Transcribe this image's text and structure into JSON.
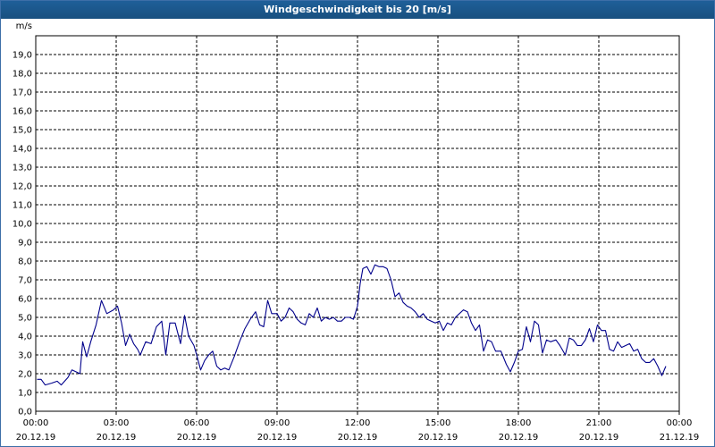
{
  "window": {
    "title": "Windgeschwindigkeit bis 20 [m/s]"
  },
  "chart_data": {
    "type": "line",
    "title": "Windgeschwindigkeit bis 20 [m/s]",
    "ylabel": "m/s",
    "xlabel": "",
    "ylim": [
      0,
      20
    ],
    "yticks": [
      "0,0",
      "1,0",
      "2,0",
      "3,0",
      "4,0",
      "5,0",
      "6,0",
      "7,0",
      "8,0",
      "9,0",
      "10,0",
      "11,0",
      "12,0",
      "13,0",
      "14,0",
      "15,0",
      "16,0",
      "17,0",
      "18,0",
      "19,0"
    ],
    "xlim": [
      0,
      24
    ],
    "xticks": [
      {
        "time": "00:00",
        "date": "20.12.19",
        "hour": 0
      },
      {
        "time": "03:00",
        "date": "20.12.19",
        "hour": 3
      },
      {
        "time": "06:00",
        "date": "20.12.19",
        "hour": 6
      },
      {
        "time": "09:00",
        "date": "20.12.19",
        "hour": 9
      },
      {
        "time": "12:00",
        "date": "20.12.19",
        "hour": 12
      },
      {
        "time": "15:00",
        "date": "20.12.19",
        "hour": 15
      },
      {
        "time": "18:00",
        "date": "20.12.19",
        "hour": 18
      },
      {
        "time": "21:00",
        "date": "20.12.19",
        "hour": 21
      },
      {
        "time": "00:00",
        "date": "21.12.19",
        "hour": 24
      }
    ],
    "grid": true,
    "line_color": "#00008b",
    "series": [
      {
        "name": "",
        "points": [
          [
            0.05,
            1.7
          ],
          [
            0.2,
            1.7
          ],
          [
            0.35,
            1.4
          ],
          [
            0.6,
            1.5
          ],
          [
            0.8,
            1.6
          ],
          [
            0.95,
            1.4
          ],
          [
            1.2,
            1.8
          ],
          [
            1.35,
            2.2
          ],
          [
            1.5,
            2.1
          ],
          [
            1.65,
            2.0
          ],
          [
            1.75,
            3.7
          ],
          [
            1.9,
            2.9
          ],
          [
            2.05,
            3.7
          ],
          [
            2.25,
            4.6
          ],
          [
            2.45,
            5.9
          ],
          [
            2.65,
            5.2
          ],
          [
            2.9,
            5.4
          ],
          [
            3.05,
            5.6
          ],
          [
            3.2,
            4.7
          ],
          [
            3.35,
            3.5
          ],
          [
            3.5,
            4.1
          ],
          [
            3.65,
            3.6
          ],
          [
            3.8,
            3.3
          ],
          [
            3.9,
            3.0
          ],
          [
            4.1,
            3.7
          ],
          [
            4.3,
            3.6
          ],
          [
            4.5,
            4.5
          ],
          [
            4.7,
            4.8
          ],
          [
            4.85,
            3.0
          ],
          [
            5.0,
            4.7
          ],
          [
            5.2,
            4.7
          ],
          [
            5.4,
            3.6
          ],
          [
            5.55,
            5.1
          ],
          [
            5.7,
            4.0
          ],
          [
            5.9,
            3.5
          ],
          [
            6.0,
            3.0
          ],
          [
            6.15,
            2.2
          ],
          [
            6.3,
            2.7
          ],
          [
            6.45,
            3.0
          ],
          [
            6.6,
            3.2
          ],
          [
            6.75,
            2.4
          ],
          [
            6.9,
            2.2
          ],
          [
            7.05,
            2.3
          ],
          [
            7.2,
            2.2
          ],
          [
            7.4,
            2.9
          ],
          [
            7.6,
            3.7
          ],
          [
            7.8,
            4.4
          ],
          [
            8.0,
            4.9
          ],
          [
            8.2,
            5.3
          ],
          [
            8.35,
            4.6
          ],
          [
            8.5,
            4.5
          ],
          [
            8.65,
            5.9
          ],
          [
            8.8,
            5.2
          ],
          [
            9.0,
            5.2
          ],
          [
            9.15,
            4.8
          ],
          [
            9.3,
            5.0
          ],
          [
            9.45,
            5.5
          ],
          [
            9.6,
            5.3
          ],
          [
            9.75,
            4.9
          ],
          [
            9.9,
            4.7
          ],
          [
            10.05,
            4.6
          ],
          [
            10.2,
            5.2
          ],
          [
            10.35,
            5.0
          ],
          [
            10.5,
            5.5
          ],
          [
            10.65,
            4.8
          ],
          [
            10.8,
            5.0
          ],
          [
            10.95,
            4.9
          ],
          [
            11.1,
            5.0
          ],
          [
            11.25,
            4.8
          ],
          [
            11.4,
            4.8
          ],
          [
            11.55,
            5.0
          ],
          [
            11.7,
            5.0
          ],
          [
            11.85,
            4.9
          ],
          [
            12.0,
            5.6
          ],
          [
            12.1,
            6.8
          ],
          [
            12.2,
            7.6
          ],
          [
            12.35,
            7.7
          ],
          [
            12.5,
            7.3
          ],
          [
            12.65,
            7.8
          ],
          [
            12.8,
            7.7
          ],
          [
            12.95,
            7.7
          ],
          [
            13.1,
            7.6
          ],
          [
            13.25,
            7.0
          ],
          [
            13.4,
            6.1
          ],
          [
            13.55,
            6.3
          ],
          [
            13.7,
            5.8
          ],
          [
            13.85,
            5.6
          ],
          [
            14.0,
            5.5
          ],
          [
            14.15,
            5.3
          ],
          [
            14.3,
            5.0
          ],
          [
            14.45,
            5.2
          ],
          [
            14.6,
            4.9
          ],
          [
            14.75,
            4.8
          ],
          [
            14.9,
            4.7
          ],
          [
            15.05,
            4.8
          ],
          [
            15.2,
            4.3
          ],
          [
            15.35,
            4.7
          ],
          [
            15.5,
            4.6
          ],
          [
            15.65,
            5.0
          ],
          [
            15.8,
            5.2
          ],
          [
            15.95,
            5.4
          ],
          [
            16.1,
            5.3
          ],
          [
            16.25,
            4.7
          ],
          [
            16.4,
            4.3
          ],
          [
            16.55,
            4.6
          ],
          [
            16.7,
            3.2
          ],
          [
            16.85,
            3.8
          ],
          [
            17.0,
            3.7
          ],
          [
            17.15,
            3.2
          ],
          [
            17.35,
            3.2
          ],
          [
            17.55,
            2.5
          ],
          [
            17.7,
            2.1
          ],
          [
            17.85,
            2.6
          ],
          [
            18.0,
            3.2
          ],
          [
            18.15,
            3.3
          ],
          [
            18.3,
            4.5
          ],
          [
            18.45,
            3.7
          ],
          [
            18.6,
            4.8
          ],
          [
            18.75,
            4.6
          ],
          [
            18.9,
            3.1
          ],
          [
            19.05,
            3.8
          ],
          [
            19.2,
            3.7
          ],
          [
            19.4,
            3.8
          ],
          [
            19.55,
            3.5
          ],
          [
            19.75,
            3.0
          ],
          [
            19.9,
            3.9
          ],
          [
            20.05,
            3.8
          ],
          [
            20.2,
            3.5
          ],
          [
            20.35,
            3.5
          ],
          [
            20.5,
            3.8
          ],
          [
            20.65,
            4.4
          ],
          [
            20.8,
            3.7
          ],
          [
            20.95,
            4.6
          ],
          [
            21.1,
            4.3
          ],
          [
            21.25,
            4.3
          ],
          [
            21.4,
            3.3
          ],
          [
            21.55,
            3.2
          ],
          [
            21.7,
            3.7
          ],
          [
            21.85,
            3.4
          ],
          [
            22.0,
            3.5
          ],
          [
            22.15,
            3.6
          ],
          [
            22.3,
            3.2
          ],
          [
            22.45,
            3.3
          ],
          [
            22.6,
            2.8
          ],
          [
            22.75,
            2.6
          ],
          [
            22.9,
            2.6
          ],
          [
            23.05,
            2.8
          ],
          [
            23.2,
            2.4
          ],
          [
            23.35,
            1.9
          ],
          [
            23.5,
            2.4
          ]
        ]
      }
    ]
  }
}
